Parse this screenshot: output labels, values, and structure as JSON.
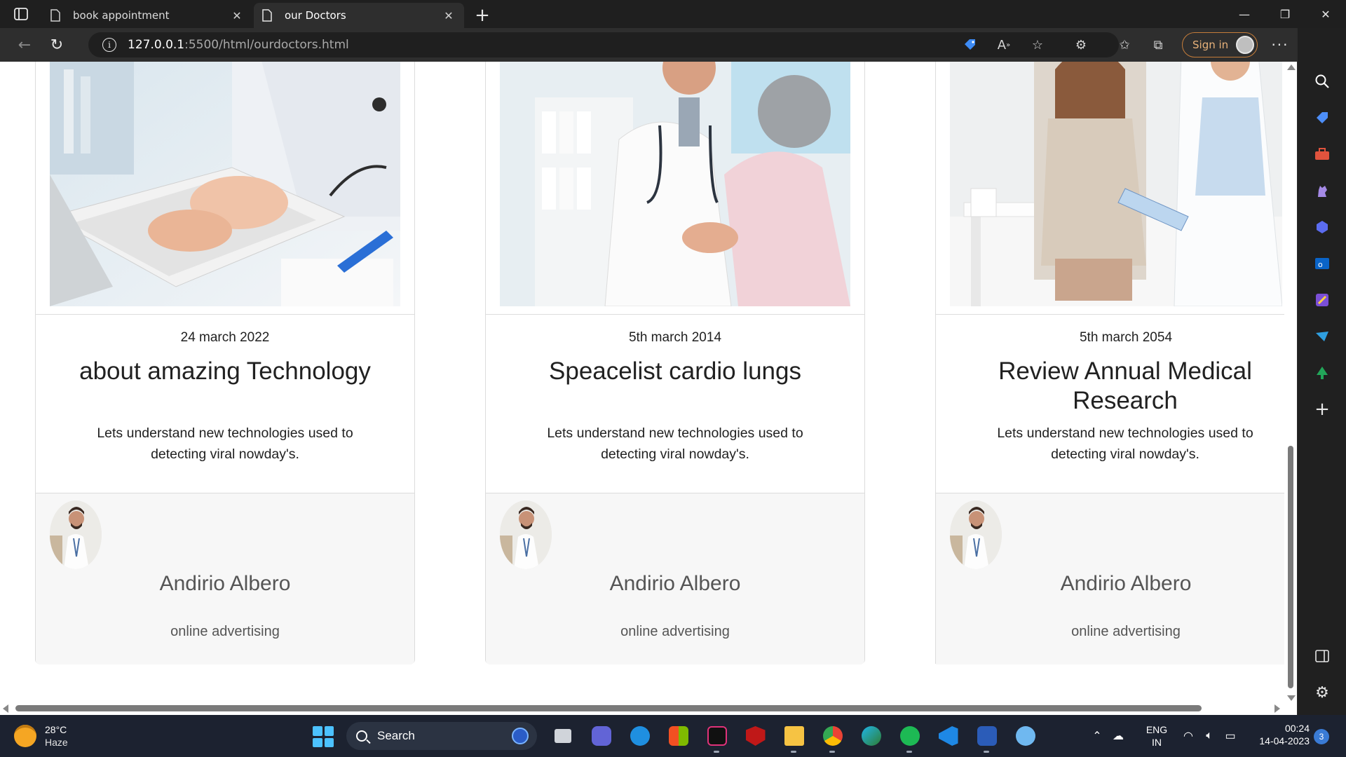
{
  "browser": {
    "tabs": [
      {
        "title": "book appointment",
        "active": false
      },
      {
        "title": "our Doctors",
        "active": true
      }
    ],
    "url_host": "127.0.0.1",
    "url_rest": ":5500/html/ourdoctors.html",
    "signin_label": "Sign in"
  },
  "cards": [
    {
      "date": "24 march 2022",
      "title": "about amazing Technology",
      "description": "Lets understand new technologies used to detecting viral nowday's.",
      "doctor_name": "Andirio Albero",
      "doctor_role": "online advertising"
    },
    {
      "date": "5th march 2014",
      "title": "Speacelist cardio lungs",
      "description": "Lets understand new technologies used to detecting viral nowday's.",
      "doctor_name": "Andirio Albero",
      "doctor_role": "online advertising"
    },
    {
      "date": "5th march 2054",
      "title": "Review Annual Medical Research",
      "description": "Lets understand new technologies used to detecting viral nowday's.",
      "doctor_name": "Andirio Albero",
      "doctor_role": "online advertising"
    }
  ],
  "taskbar": {
    "weather_temp": "28°C",
    "weather_cond": "Haze",
    "search_label": "Search",
    "lang_line1": "ENG",
    "lang_line2": "IN",
    "time": "00:24",
    "date": "14-04-2023",
    "notification_count": "3"
  },
  "colors": {
    "accent": "#4cc2ff",
    "signin_border": "#c57d3a",
    "text": "#212121"
  }
}
